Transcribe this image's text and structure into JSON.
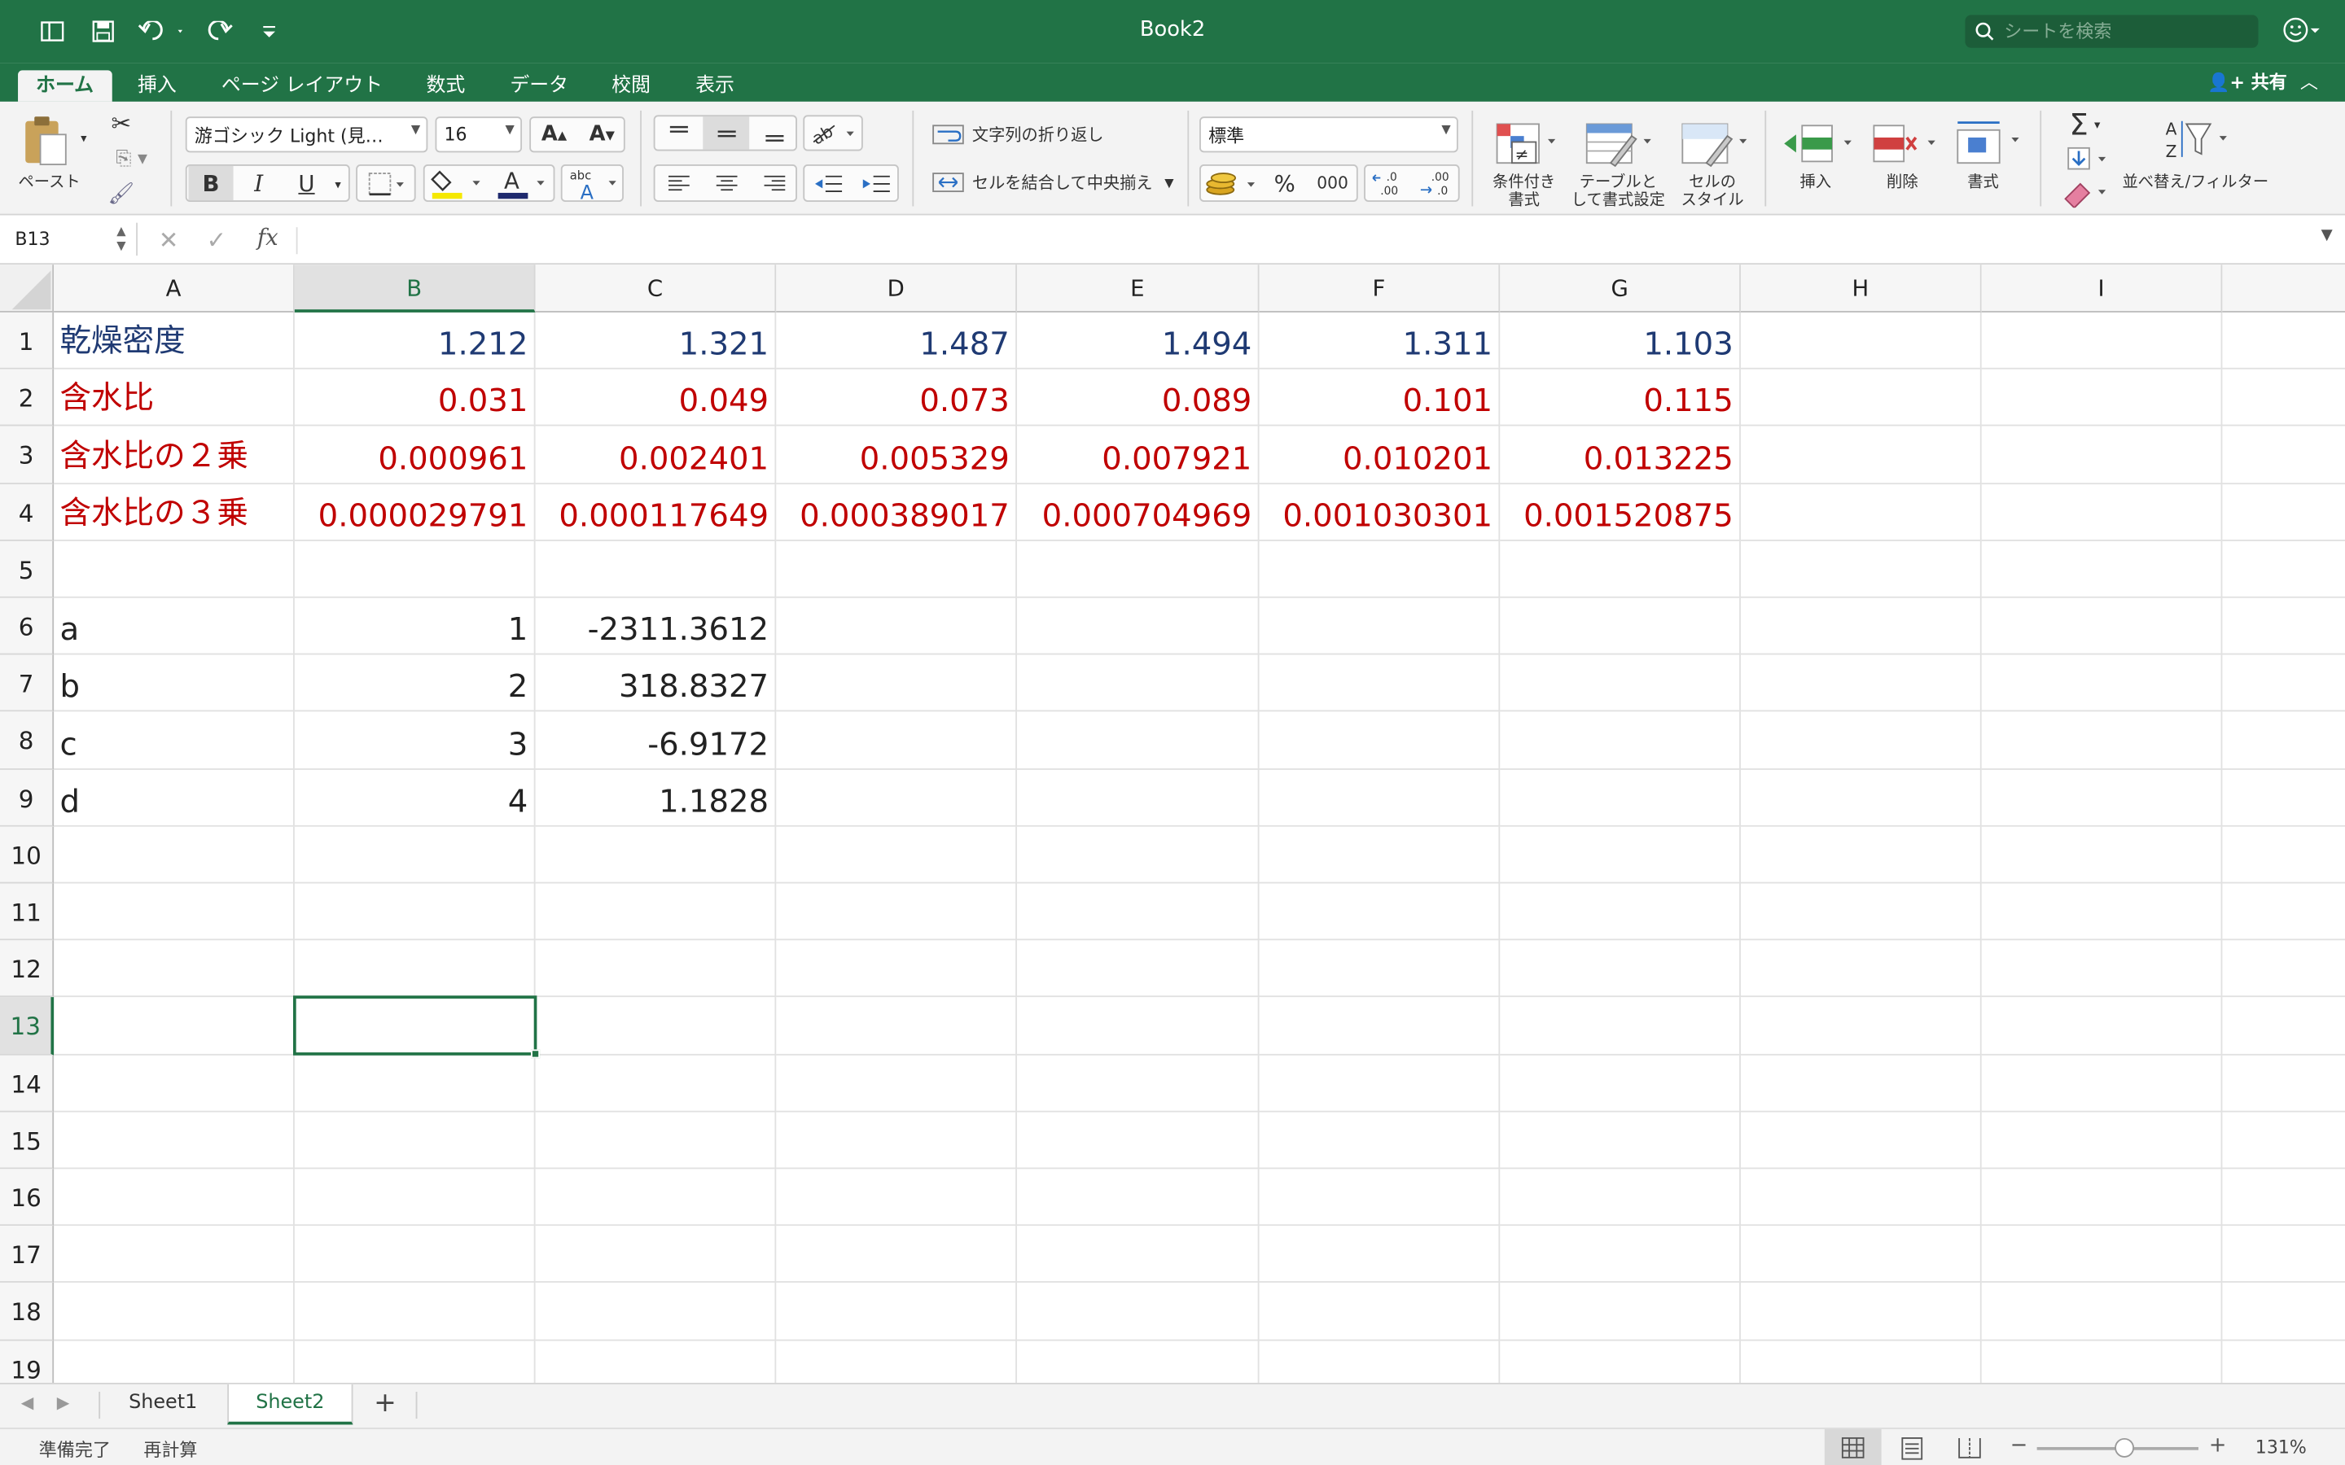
{
  "window": {
    "title": "Book2",
    "search_placeholder": "シートを検索",
    "share_label": "共有"
  },
  "ribbon_tabs": [
    "ホーム",
    "挿入",
    "ページ レイアウト",
    "数式",
    "データ",
    "校閲",
    "表示"
  ],
  "ribbon": {
    "paste_label": "ペースト",
    "font_name": "游ゴシック Light (見…",
    "font_size": "16",
    "wrap_text_label": "文字列の折り返し",
    "merge_center_label": "セルを結合して中央揃え",
    "number_format": "標準",
    "percent_label": "%",
    "comma_label": "000",
    "conditional_format_label": [
      "条件付き",
      "書式"
    ],
    "format_as_table_label": [
      "テーブルと",
      "して書式設定"
    ],
    "cell_styles_label": [
      "セルの",
      "スタイル"
    ],
    "insert_label": "挿入",
    "delete_label": "削除",
    "format_label": "書式",
    "sort_filter_label": "並べ替え/フィルター",
    "bold": "B",
    "italic": "I",
    "underline": "U"
  },
  "formula_bar": {
    "name_box": "B13",
    "fx_label": "fx",
    "formula": ""
  },
  "columns": [
    "A",
    "B",
    "C",
    "D",
    "E",
    "F",
    "G",
    "H",
    "I"
  ],
  "rows": [
    "1",
    "2",
    "3",
    "4",
    "5",
    "6",
    "7",
    "8",
    "9",
    "10",
    "11",
    "12",
    "13",
    "14",
    "15",
    "16",
    "17",
    "18",
    "19"
  ],
  "cells": {
    "A1": "乾燥密度",
    "B1": "1.212",
    "C1": "1.321",
    "D1": "1.487",
    "E1": "1.494",
    "F1": "1.311",
    "G1": "1.103",
    "A2": "含水比",
    "B2": "0.031",
    "C2": "0.049",
    "D2": "0.073",
    "E2": "0.089",
    "F2": "0.101",
    "G2": "0.115",
    "A3": "含水比の２乗",
    "B3": "0.000961",
    "C3": "0.002401",
    "D3": "0.005329",
    "E3": "0.007921",
    "F3": "0.010201",
    "G3": "0.013225",
    "A4": "含水比の３乗",
    "B4": "0.000029791",
    "C4": "0.000117649",
    "D4": "0.000389017",
    "E4": "0.000704969",
    "F4": "0.001030301",
    "G4": "0.001520875",
    "A6": "a",
    "B6": "1",
    "C6": "-2311.3612",
    "A7": "b",
    "B7": "2",
    "C7": "318.8327",
    "A8": "c",
    "B8": "3",
    "C8": "-6.9172",
    "A9": "d",
    "B9": "4",
    "C9": "1.1828"
  },
  "cell_colors": {
    "row1": "#1f3a73",
    "rows2_4": "#c00000"
  },
  "active_cell": "B13",
  "sheets": [
    "Sheet1",
    "Sheet2"
  ],
  "active_sheet": "Sheet2",
  "status": {
    "ready": "準備完了",
    "recalc": "再計算",
    "zoom": "131%"
  },
  "accent_color": "#217346"
}
